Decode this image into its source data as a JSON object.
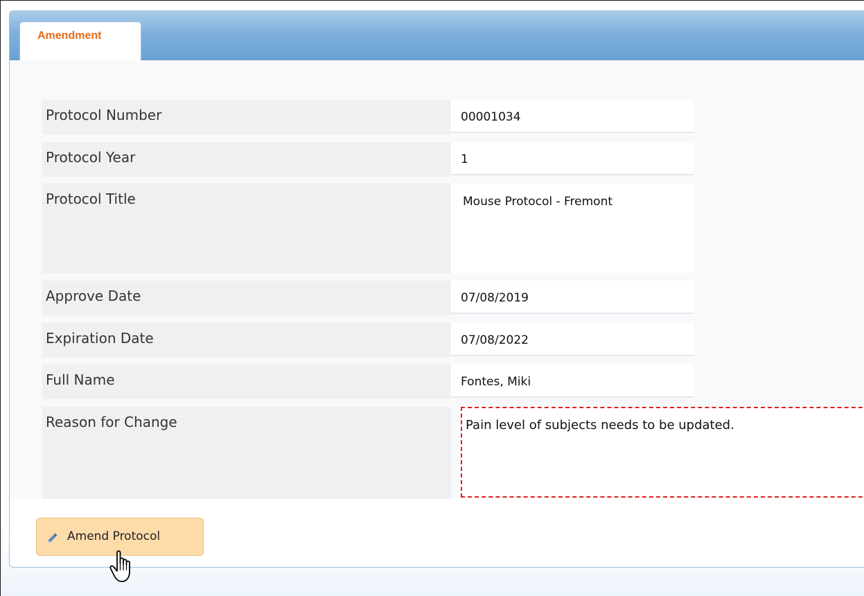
{
  "tabs": [
    {
      "label": "Amendment",
      "active": true
    }
  ],
  "form": {
    "protocol_number": {
      "label": "Protocol Number",
      "value": "00001034"
    },
    "protocol_year": {
      "label": "Protocol Year",
      "value": "1"
    },
    "protocol_title": {
      "label": "Protocol Title",
      "value": "Mouse Protocol - Fremont"
    },
    "approve_date": {
      "label": "Approve Date",
      "value": "07/08/2019"
    },
    "expiration_date": {
      "label": "Expiration Date",
      "value": "07/08/2022"
    },
    "full_name": {
      "label": "Full Name",
      "value": "Fontes, Miki"
    },
    "reason_for_change": {
      "label": "Reason for Change",
      "value": "Pain level of subjects needs to be updated."
    }
  },
  "actions": {
    "amend_label": "Amend Protocol",
    "amend_icon": "pencil-icon"
  },
  "colors": {
    "tab_label": "#e36c1a",
    "tab_bar": "#7fb0dc",
    "button_bg": "#fddcaa",
    "required_border": "#e2211c"
  }
}
